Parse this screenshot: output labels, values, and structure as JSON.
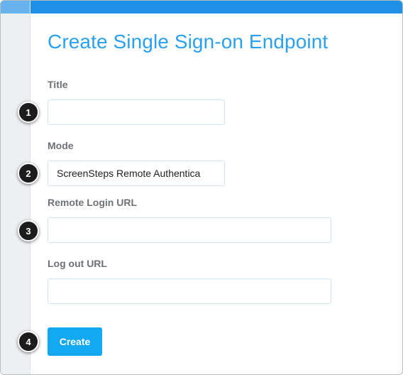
{
  "page": {
    "title": "Create Single Sign-on Endpoint"
  },
  "form": {
    "title_label": "Title",
    "title_value": "",
    "mode_label": "Mode",
    "mode_selected": "ScreenSteps Remote Authentica",
    "remote_login_url_label": "Remote Login URL",
    "remote_login_url_value": "",
    "logout_url_label": "Log out URL",
    "logout_url_value": "",
    "create_label": "Create"
  },
  "annotations": [
    "1",
    "2",
    "3",
    "4"
  ],
  "colors": {
    "accent": "#1e90e8",
    "title": "#2aa0f0",
    "button": "#12a9f2",
    "sidebar": "#edf0f3"
  }
}
